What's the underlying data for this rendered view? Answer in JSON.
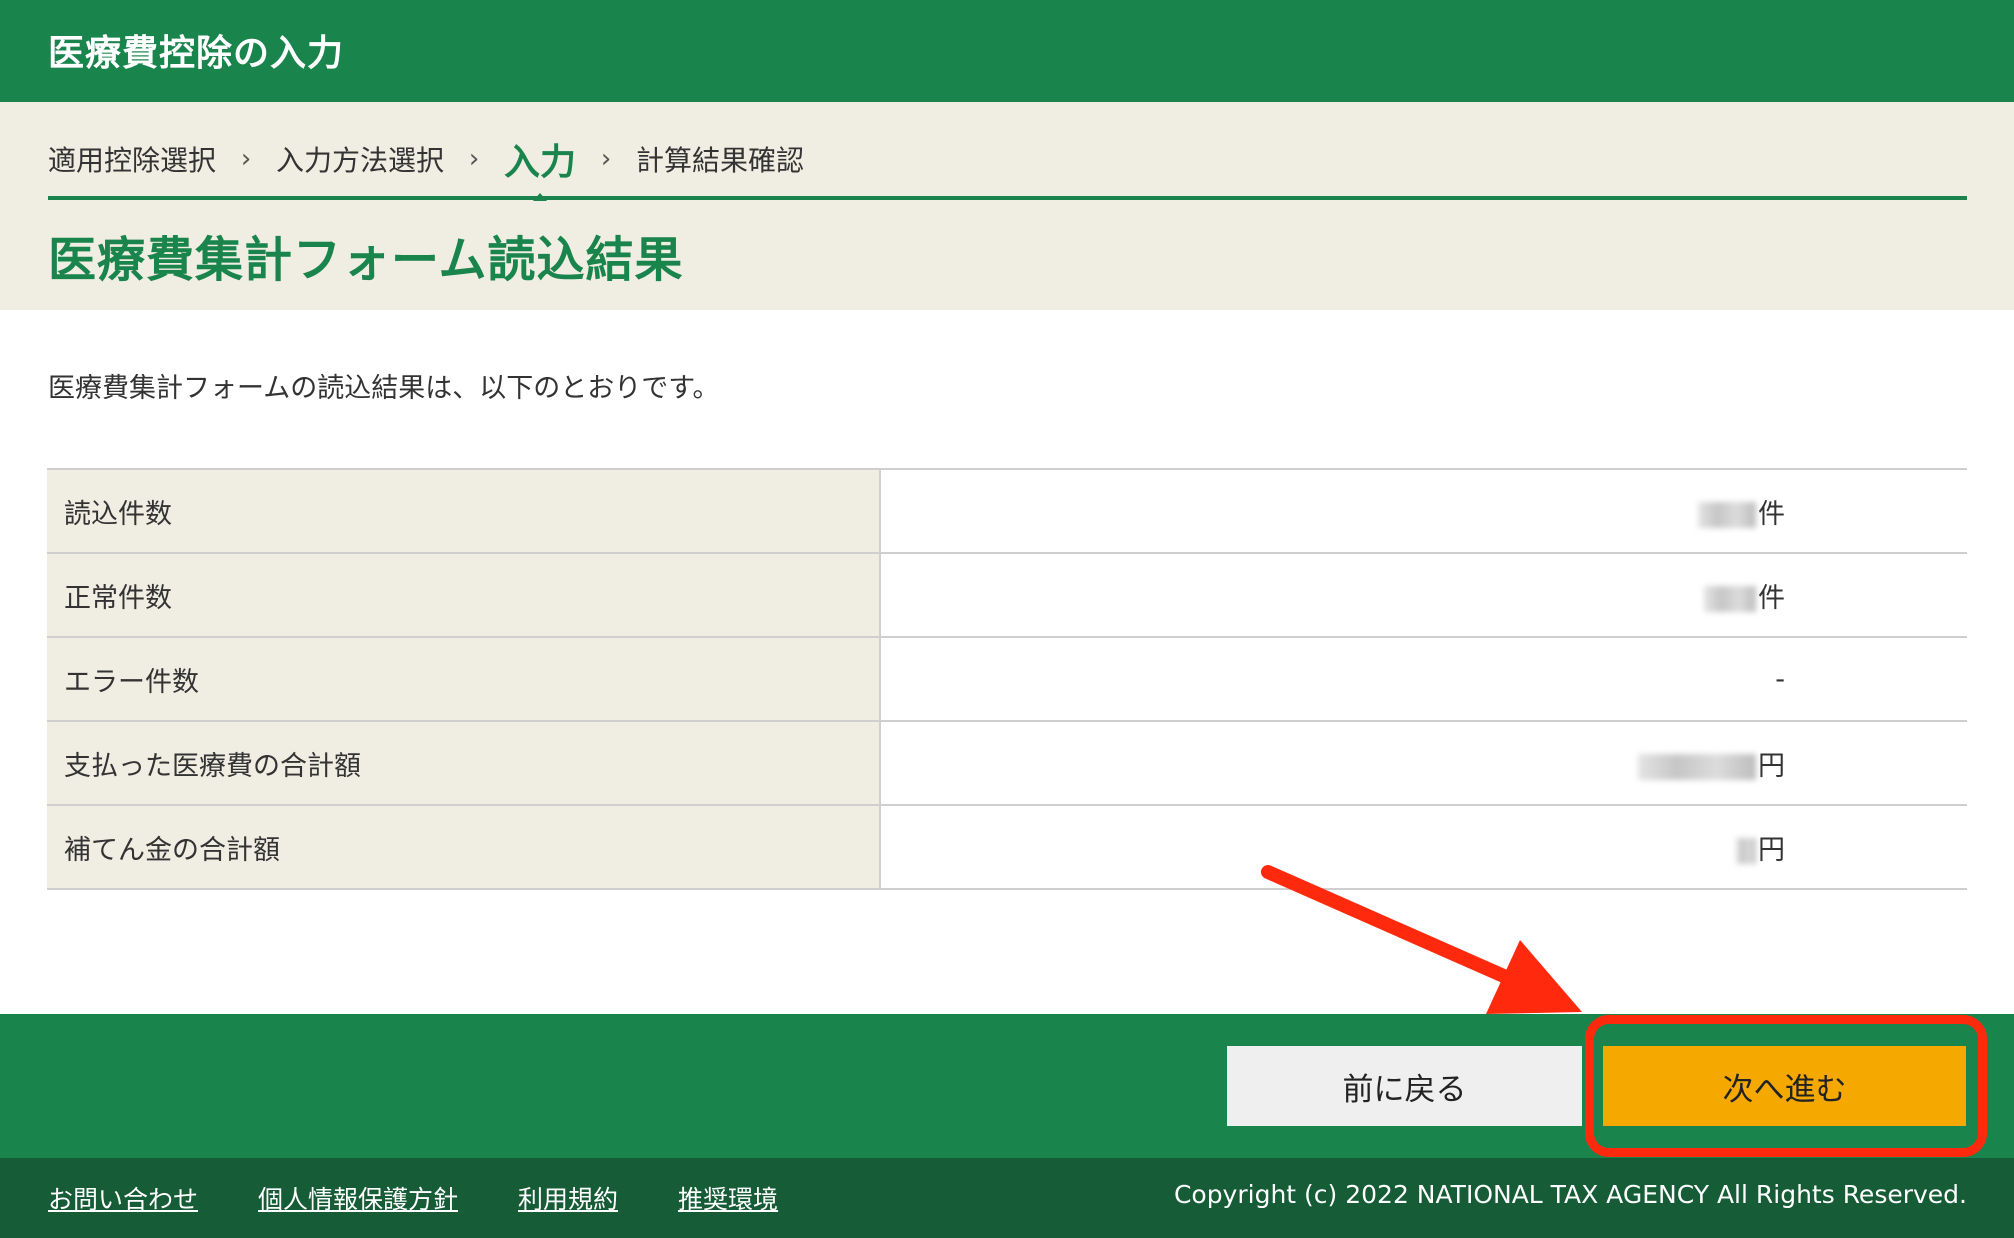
{
  "header": {
    "title": "医療費控除の入力"
  },
  "progress": {
    "steps": [
      "適用控除選択",
      "入力方法選択",
      "入力",
      "計算結果確認"
    ],
    "active_index": 2
  },
  "page_title": "医療費集計フォーム読込結果",
  "intro": "医療費集計フォームの読込結果は、以下のとおりです。",
  "results": [
    {
      "label": "読込件数",
      "value_suffix": "件",
      "redacted": true
    },
    {
      "label": "正常件数",
      "value_suffix": "件",
      "redacted": true
    },
    {
      "label": "エラー件数",
      "value_suffix": "-",
      "redacted": false
    },
    {
      "label": "支払った医療費の合計額",
      "value_suffix": "円",
      "redacted": true
    },
    {
      "label": "補てん金の合計額",
      "value_suffix": "円",
      "redacted": true
    }
  ],
  "buttons": {
    "back": "前に戻る",
    "next": "次へ進む"
  },
  "footer": {
    "links": [
      "お問い合わせ",
      "個人情報保護方針",
      "利用規約",
      "推奨環境"
    ],
    "copyright": "Copyright (c) 2022 NATIONAL TAX AGENCY All Rights Reserved."
  },
  "colors": {
    "brand_green": "#1a844d",
    "footer_green": "#165c36",
    "band_beige": "#f0ede3",
    "next_button": "#f5a800",
    "annotation_red": "#ff2a0d"
  }
}
